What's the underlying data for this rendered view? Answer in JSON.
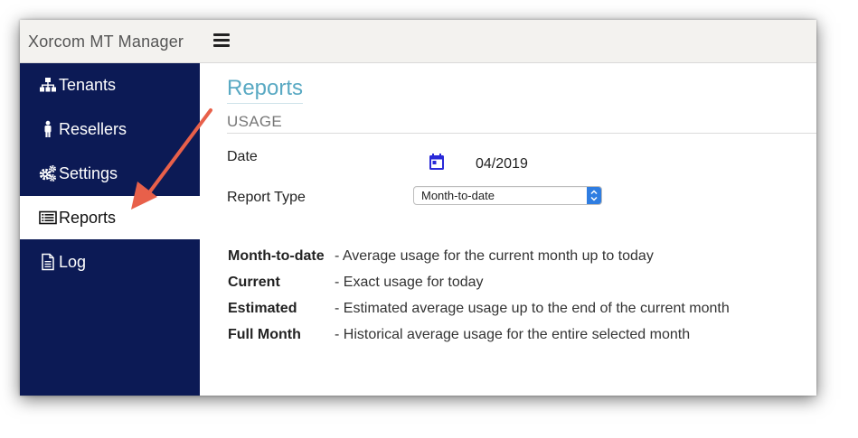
{
  "app": {
    "title": "Xorcom MT Manager"
  },
  "sidebar": {
    "items": [
      {
        "label": "Tenants",
        "icon": "sitemap-icon"
      },
      {
        "label": "Resellers",
        "icon": "person-icon"
      },
      {
        "label": "Settings",
        "icon": "gears-icon"
      },
      {
        "label": "Reports",
        "icon": "list-icon",
        "active": true
      },
      {
        "label": "Log",
        "icon": "document-icon"
      }
    ]
  },
  "page": {
    "title": "Reports",
    "section": "USAGE",
    "date_label": "Date",
    "date_value": "04/2019",
    "report_type_label": "Report Type",
    "report_type_value": "Month-to-date"
  },
  "descriptions": [
    {
      "term": "Month-to-date",
      "text": "- Average usage for the current month up to today"
    },
    {
      "term": "Current",
      "text": "- Exact usage for today"
    },
    {
      "term": "Estimated",
      "text": "- Estimated average usage up to the end of the current month"
    },
    {
      "term": "Full Month",
      "text": "- Historical average usage for the entire selected month"
    }
  ],
  "colors": {
    "sidebar_bg": "#0c1a55",
    "title_accent": "#59a9c3",
    "annotation_arrow": "#e8604a",
    "calendar_icon": "#2a2ad8",
    "select_arrow_bg": "#2f7de1"
  }
}
